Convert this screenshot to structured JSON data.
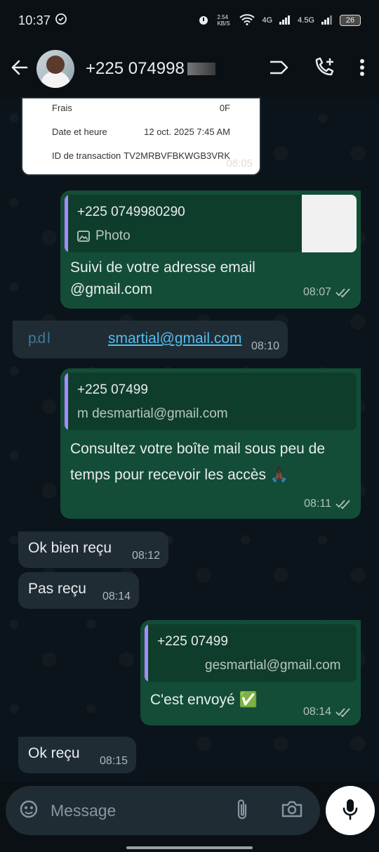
{
  "status": {
    "time": "10:37",
    "speed": "2.54 KB/S",
    "net1": "4G",
    "net2": "4.5G",
    "battery": "26"
  },
  "header": {
    "contact_name": "+225 074998"
  },
  "receipt": {
    "rows": [
      {
        "label": "Frais",
        "value": "0F"
      },
      {
        "label": "Date et heure",
        "value": "12 oct. 2025 7:45 AM"
      },
      {
        "label": "ID de transaction",
        "value": "TV2MRBVFBKWGB3VRK"
      }
    ],
    "time": "08:05"
  },
  "messages": [
    {
      "quote_title": "+225 0749980290",
      "quote_sub": "Photo",
      "text_line1": "Suivi de votre adresse email",
      "text_line2": "@gmail.com",
      "time": "08:07"
    },
    {
      "link": "smartial@gmail.com",
      "link_prefix": "p.d   l",
      "time": "08:10"
    },
    {
      "quote_title": "+225 07499",
      "quote_sub": "m    desmartial@gmail.com",
      "text_line1": "Consultez votre boîte mail sous peu de",
      "text_line2": "temps pour recevoir les accès 🙏🏿",
      "time": "08:11"
    },
    {
      "text": "Ok bien reçu",
      "time": "08:12"
    },
    {
      "text": "Pas reçu",
      "time": "08:14"
    },
    {
      "quote_title": "+225 07499",
      "quote_sub": "gesmartial@gmail.com",
      "text": "C'est envoyé ✅",
      "time": "08:14"
    },
    {
      "text": "Ok reçu",
      "time": "08:15"
    }
  ],
  "composer": {
    "placeholder": "Message"
  },
  "colors": {
    "out_bubble": "#134d37",
    "in_bubble": "#202c33",
    "link": "#53bdeb",
    "quote_bar": "#a78bfa"
  }
}
